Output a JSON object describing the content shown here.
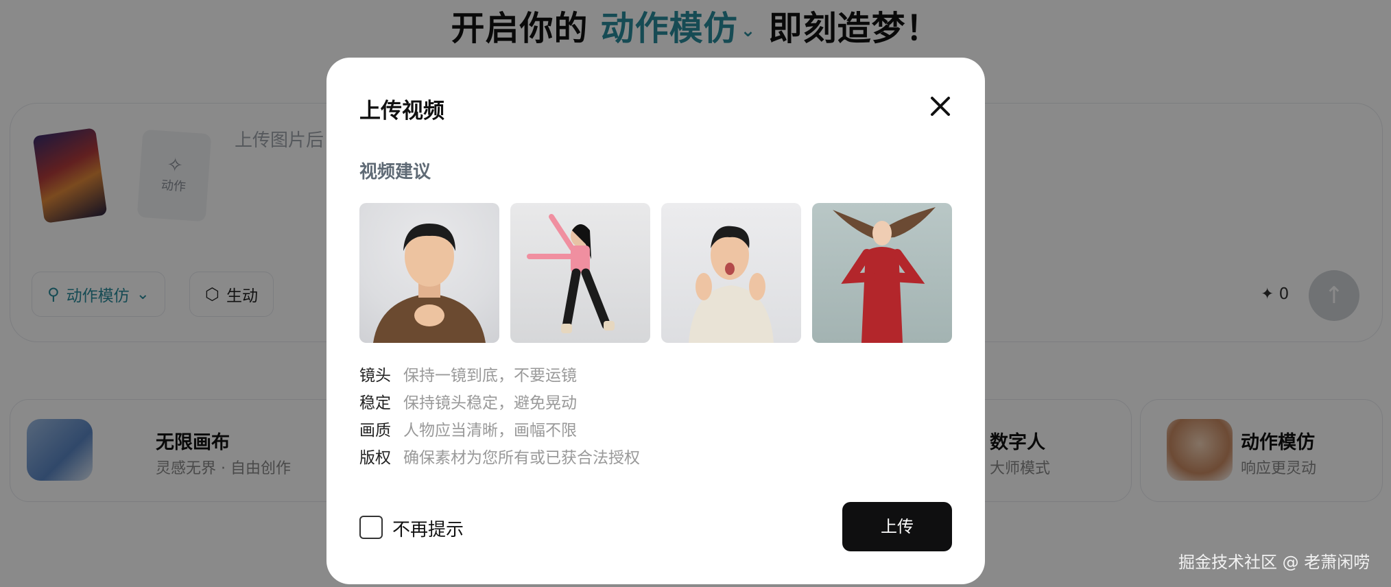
{
  "page": {
    "title_prefix": "开启你的",
    "title_accent": "动作模仿",
    "title_suffix": "即刻造梦！"
  },
  "composer": {
    "action_thumb_label": "动作",
    "placeholder": "上传图片后",
    "mode_pill": "动作模仿",
    "style_pill": "生动",
    "credits": "0"
  },
  "features": [
    {
      "title": "无限画布",
      "subtitle": "灵感无界 · 自由创作"
    },
    {
      "title": "数字人",
      "subtitle": "大师模式"
    },
    {
      "title": "动作模仿",
      "subtitle": "响应更灵动"
    }
  ],
  "modal": {
    "title": "上传视频",
    "section_title": "视频建议",
    "tips": [
      {
        "key": "镜头",
        "value": "保持一镜到底，不要运镜"
      },
      {
        "key": "稳定",
        "value": "保持镜头稳定，避免晃动"
      },
      {
        "key": "画质",
        "value": "人物应当清晰，画幅不限"
      },
      {
        "key": "版权",
        "value": "确保素材为您所有或已获合法授权"
      }
    ],
    "checkbox_label": "不再提示",
    "upload_button": "上传"
  },
  "watermark": "掘金技术社区 @ 老萧闲唠",
  "colors": {
    "accent": "#2a8b9b",
    "primary_button": "#0f0f10",
    "overlay": "rgba(0,0,0,0.46)"
  }
}
